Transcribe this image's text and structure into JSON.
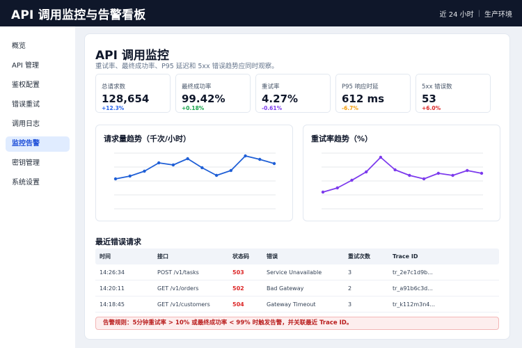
{
  "header": {
    "title": "API 调用监控与告警看板",
    "time_range": "近 24 小时",
    "divider": "|",
    "environment": "生产环境"
  },
  "sidebar": {
    "items": [
      {
        "label": "概览",
        "active": false
      },
      {
        "label": "API 管理",
        "active": false
      },
      {
        "label": "鉴权配置",
        "active": false
      },
      {
        "label": "错误重试",
        "active": false
      },
      {
        "label": "调用日志",
        "active": false
      },
      {
        "label": "监控告警",
        "active": true
      },
      {
        "label": "密钥管理",
        "active": false
      },
      {
        "label": "系统设置",
        "active": false
      }
    ]
  },
  "main": {
    "title": "API 调用监控",
    "subtitle": "重试率、最终成功率、P95 延迟和 5xx 错误趋势应同时观察。"
  },
  "kpis": [
    {
      "label": "总请求数",
      "value": "128,654",
      "delta": "+12.3%",
      "delta_color": "#2563eb"
    },
    {
      "label": "最终成功率",
      "value": "99.42%",
      "delta": "+0.18%",
      "delta_color": "#16a34a"
    },
    {
      "label": "重试率",
      "value": "4.27%",
      "delta": "-0.61%",
      "delta_color": "#7c3aed"
    },
    {
      "label": "P95 响应时延",
      "value": "612 ms",
      "delta": "-6.7%",
      "delta_color": "#f59e0b"
    },
    {
      "label": "5xx 错误数",
      "value": "53",
      "delta": "+6.0%",
      "delta_color": "#dc2626"
    }
  ],
  "chart_data": [
    {
      "type": "line",
      "title": "请求量趋势（千次/小时）",
      "color": "#1f5fd6",
      "grid": true,
      "series": [
        {
          "values": [
            4.3,
            4.7,
            5.4,
            6.6,
            6.3,
            7.2,
            5.9,
            4.8,
            5.5,
            7.6,
            7.1,
            6.5
          ]
        }
      ]
    },
    {
      "type": "line",
      "title": "重试率趋势（%）",
      "color": "#7c3aed",
      "grid": true,
      "series": [
        {
          "values": [
            2.4,
            3.0,
            4.1,
            5.3,
            7.4,
            5.6,
            4.8,
            4.3,
            5.1,
            4.8,
            5.5,
            5.1
          ]
        }
      ]
    }
  ],
  "errors": {
    "title": "最近错误请求",
    "columns": [
      "时间",
      "接口",
      "状态码",
      "错误",
      "重试次数",
      "Trace ID"
    ],
    "rows": [
      [
        "14:26:34",
        "POST /v1/tasks",
        "503",
        "Service Unavailable",
        "3",
        "tr_2e7c1d9b..."
      ],
      [
        "14:20:11",
        "GET /v1/orders",
        "502",
        "Bad Gateway",
        "2",
        "tr_a91b6c3d..."
      ],
      [
        "14:18:45",
        "GET /v1/customers",
        "504",
        "Gateway Timeout",
        "3",
        "tr_k112m3n4..."
      ]
    ]
  },
  "alert": {
    "text": "告警规则：5分钟重试率 > 10% 或最终成功率 < 99% 时触发告警，并关联最近 Trace ID。",
    "color": "#b91c1c"
  },
  "colors": {
    "topbar": "#0f172a",
    "accent": "#1d4ed8",
    "active_bg": "#e0ecff"
  }
}
